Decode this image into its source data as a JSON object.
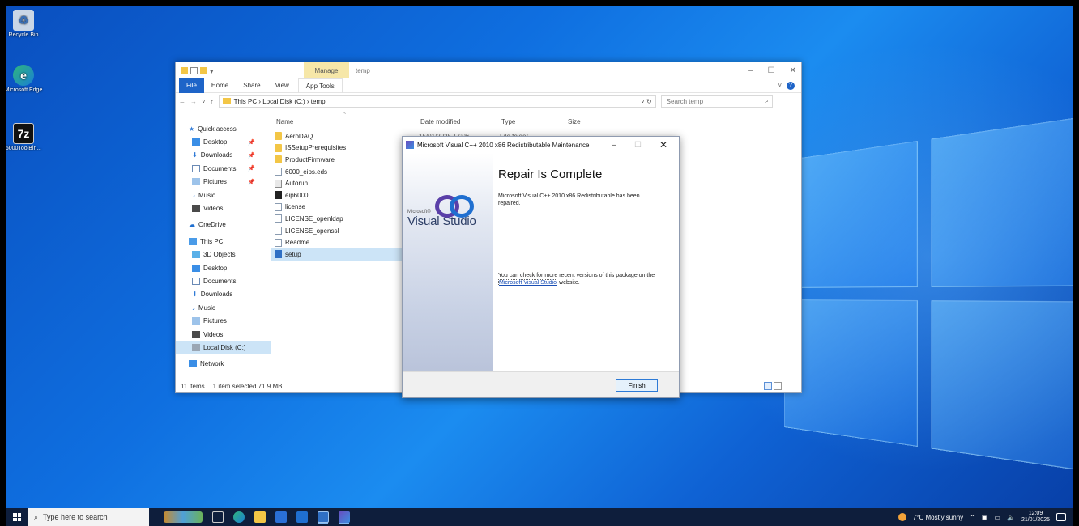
{
  "desktop": {
    "icons": [
      {
        "label": "Recycle Bin",
        "glyph": "recycle-bin-icon"
      },
      {
        "label": "Microsoft Edge",
        "glyph": "edge-icon"
      },
      {
        "label": "6000ToolBin...",
        "glyph": "7zip-icon"
      }
    ]
  },
  "explorer": {
    "manage_label": "Manage",
    "title": "temp",
    "ribbon_tabs": [
      "File",
      "Home",
      "Share",
      "View",
      "App Tools"
    ],
    "address_path": "This PC  ›  Local Disk (C:)  ›  temp",
    "search_placeholder": "Search temp",
    "nav": {
      "quick_access": "Quick access",
      "quick_items": [
        "Desktop",
        "Downloads",
        "Documents",
        "Pictures",
        "Music",
        "Videos"
      ],
      "onedrive": "OneDrive",
      "this_pc": "This PC",
      "pc_items": [
        "3D Objects",
        "Desktop",
        "Documents",
        "Downloads",
        "Music",
        "Pictures",
        "Videos",
        "Local Disk (C:)"
      ],
      "network": "Network"
    },
    "columns": {
      "name": "Name",
      "date": "Date modified",
      "type": "Type",
      "size": "Size"
    },
    "first_row": {
      "date": "15/01/2025 17:06",
      "type": "File folder"
    },
    "files": [
      {
        "name": "AeroDAQ",
        "kind": "folder"
      },
      {
        "name": "ISSetupPrerequisites",
        "kind": "folder"
      },
      {
        "name": "ProductFirmware",
        "kind": "folder"
      },
      {
        "name": "6000_eips.eds",
        "kind": "doc"
      },
      {
        "name": "Autorun",
        "kind": "sys"
      },
      {
        "name": "eip6000",
        "kind": "eip"
      },
      {
        "name": "license",
        "kind": "doc"
      },
      {
        "name": "LICENSE_openldap",
        "kind": "doc"
      },
      {
        "name": "LICENSE_openssl",
        "kind": "doc"
      },
      {
        "name": "Readme",
        "kind": "doc"
      },
      {
        "name": "setup",
        "kind": "setup"
      }
    ],
    "status": {
      "items": "11 items",
      "selected": "1 item selected  71.9 MB"
    }
  },
  "dialog": {
    "title": "Microsoft Visual C++ 2010  x86 Redistributable Maintenance",
    "brand_small": "Microsoft®",
    "brand": "Visual Studio",
    "heading": "Repair Is Complete",
    "message": "Microsoft Visual C++ 2010  x86 Redistributable has been repaired.",
    "check_prefix": "You can check for more recent versions of this package on the ",
    "link_text": "Microsoft Visual Studio",
    "check_suffix": " website.",
    "finish_label": "Finish"
  },
  "taskbar": {
    "search_placeholder": "Type here to search",
    "weather": "7°C  Mostly sunny",
    "time": "12:09",
    "date": "21/01/2025"
  }
}
